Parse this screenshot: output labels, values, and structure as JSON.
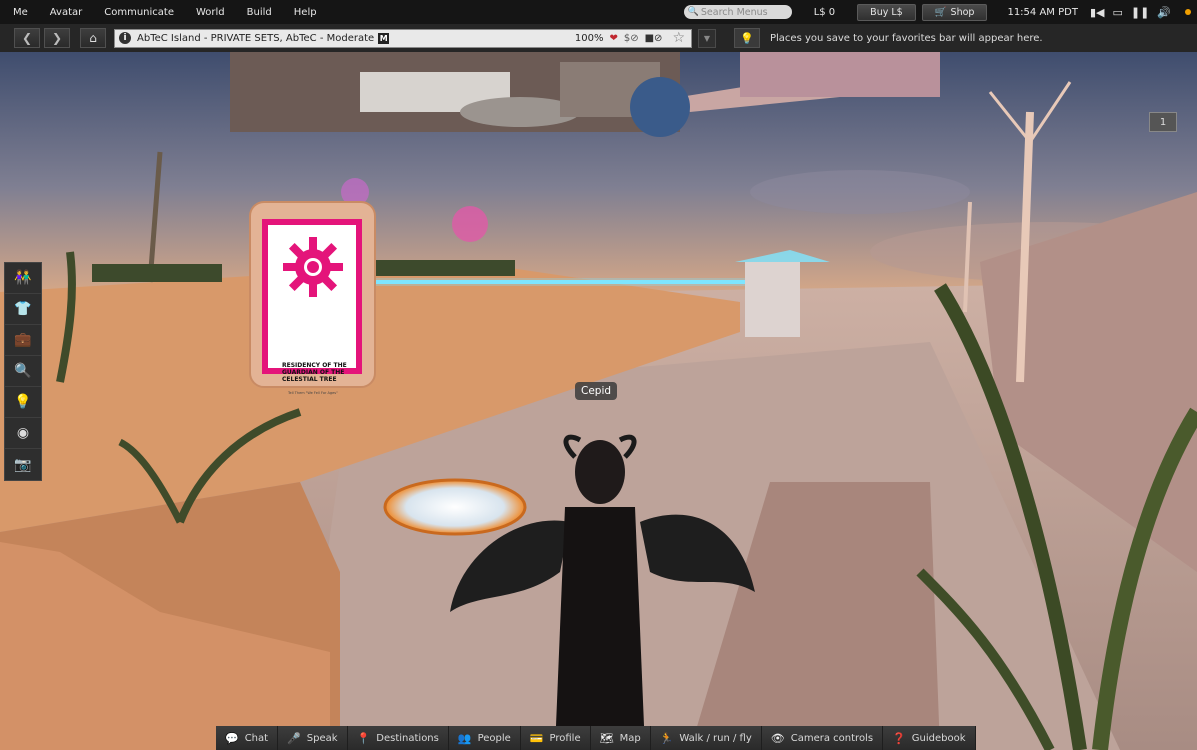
{
  "menubar": {
    "items": [
      "Me",
      "Avatar",
      "Communicate",
      "World",
      "Build",
      "Help"
    ],
    "search_placeholder": "Search Menus",
    "balance": "L$ 0",
    "buy_label": "Buy L$",
    "shop_label": "Shop",
    "clock": "11:54 AM PDT"
  },
  "navbar": {
    "location": "AbTeC Island - PRIVATE SETS, AbTeC - Moderate",
    "maturity_badge": "M",
    "zoom": "100%",
    "favorites_hint": "Places you save to your favorites bar will appear here."
  },
  "world": {
    "avatar_name": "Cepid",
    "minimap_label": "1",
    "sign": {
      "title": "RESIDENCY OF THE GUARDIAN OF THE CELESTIAL TREE",
      "subtitle": "Tell Them \"We Fell For Ages\""
    }
  },
  "bottom_toolbar": [
    {
      "label": "Chat",
      "icon": "chat-bubble-icon"
    },
    {
      "label": "Speak",
      "icon": "microphone-icon"
    },
    {
      "label": "Destinations",
      "icon": "map-pin-icon"
    },
    {
      "label": "People",
      "icon": "people-icon"
    },
    {
      "label": "Profile",
      "icon": "id-card-icon"
    },
    {
      "label": "Map",
      "icon": "map-icon"
    },
    {
      "label": "Walk / run / fly",
      "icon": "walking-person-icon"
    },
    {
      "label": "Camera controls",
      "icon": "eye-icon"
    },
    {
      "label": "Guidebook",
      "icon": "question-book-icon"
    }
  ],
  "left_toolbar": [
    "people-icon",
    "shirt-icon",
    "inventory-icon",
    "search-icon",
    "place-icon",
    "nearby-voice-icon",
    "snapshot-icon"
  ],
  "colors": {
    "sign_accent": "#e4147a",
    "sky_top": "#4d5a78",
    "terrain": "#d89a6c"
  }
}
